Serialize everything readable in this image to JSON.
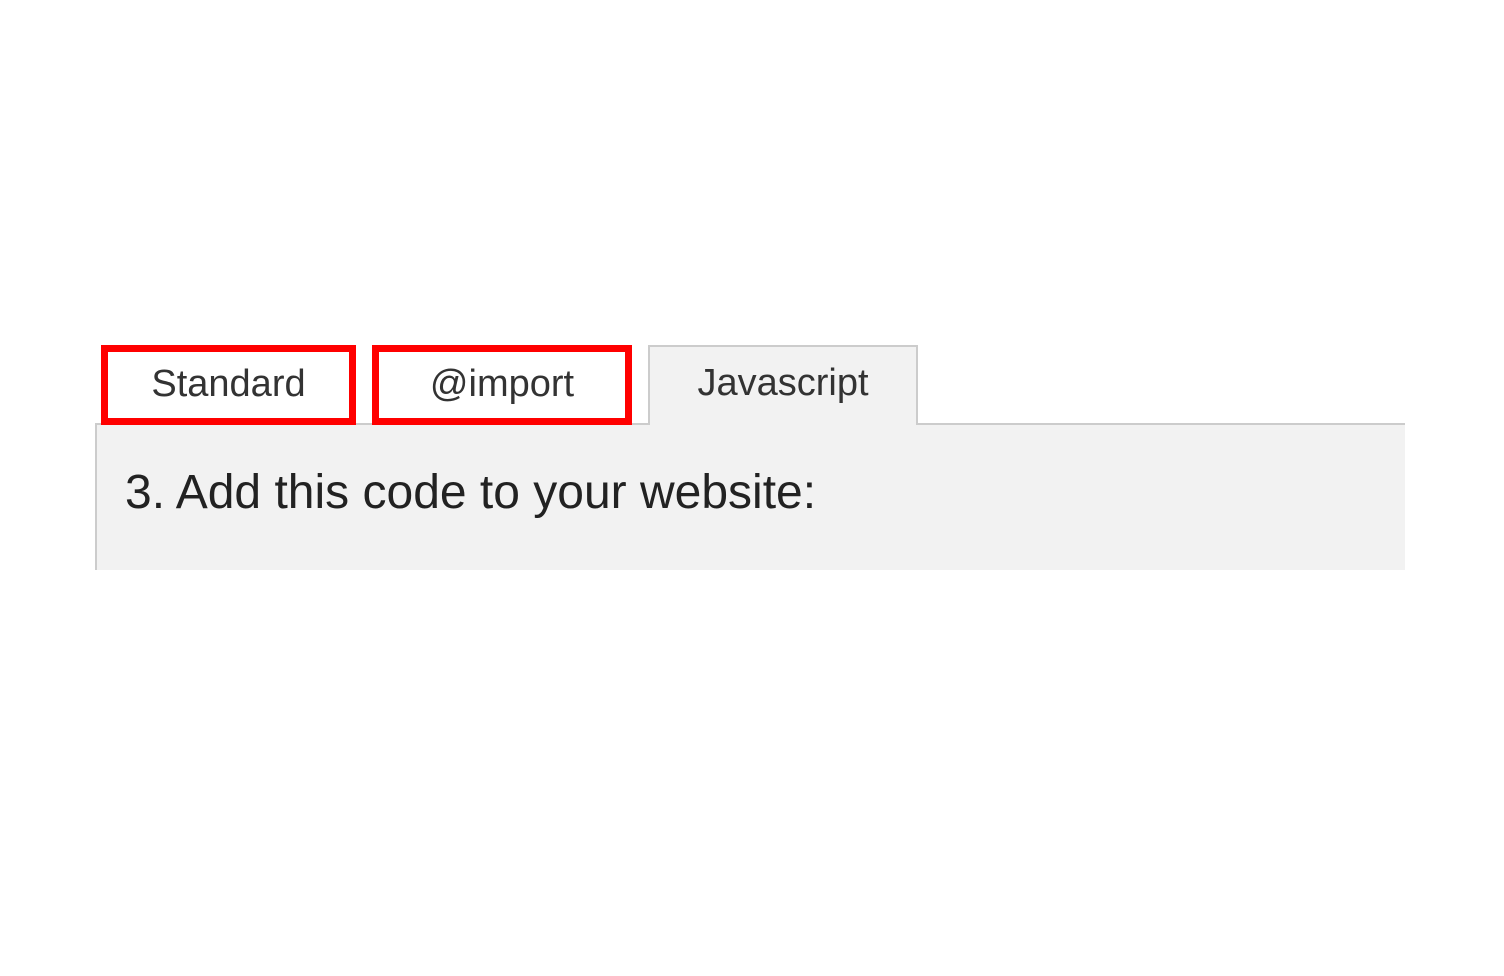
{
  "tabs": {
    "standard": "Standard",
    "import": "@import",
    "javascript": "Javascript"
  },
  "content": {
    "instruction": "3. Add this code to your website:"
  }
}
